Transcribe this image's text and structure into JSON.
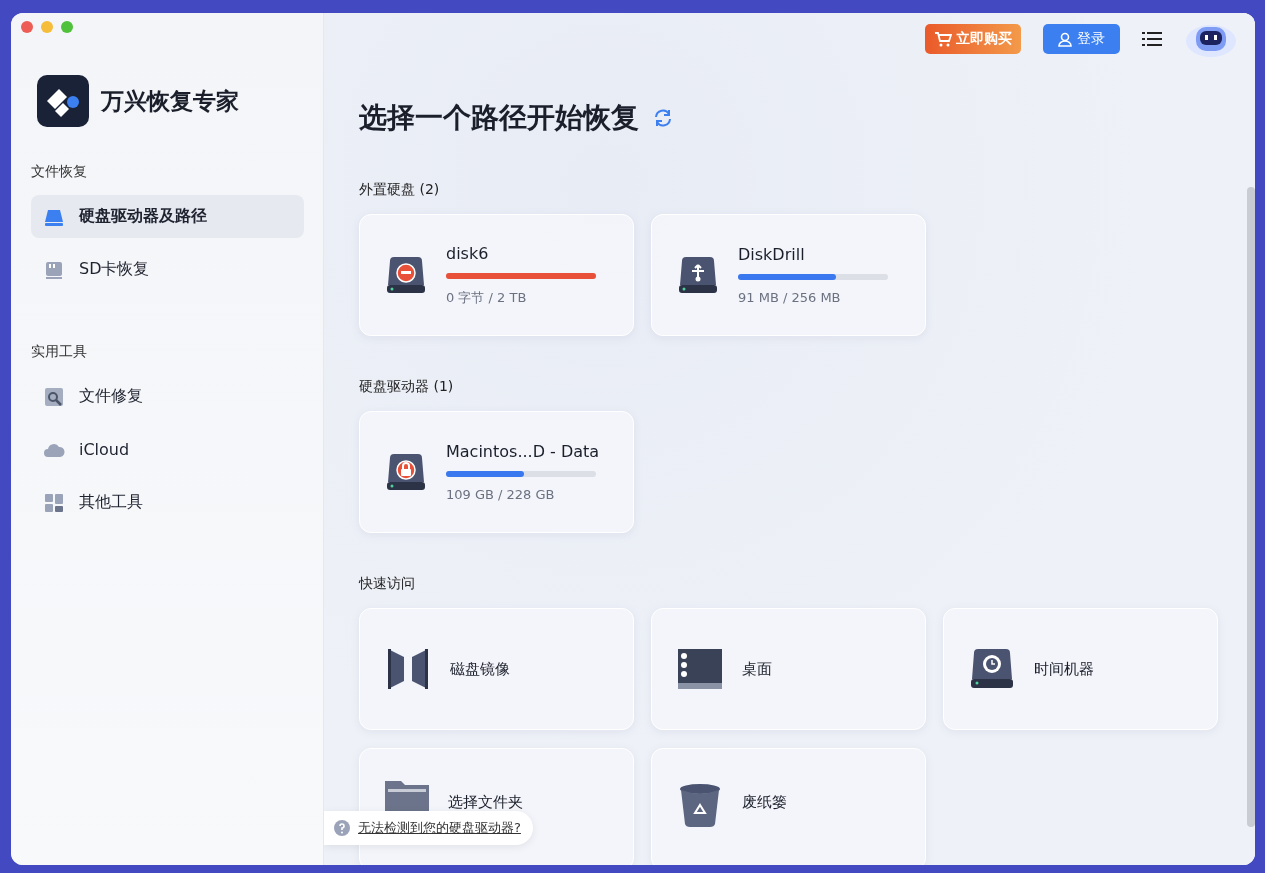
{
  "topbar": {
    "buy_button": "立即购买",
    "login_button": "登录"
  },
  "sidebar": {
    "app_name": "万兴恢复专家",
    "sections": [
      {
        "title": "文件恢复",
        "items": [
          {
            "label": "硬盘驱动器及路径",
            "kind": "drive",
            "selected": true
          },
          {
            "label": "SD卡恢复",
            "kind": "sd",
            "selected": false
          }
        ]
      },
      {
        "title": "实用工具",
        "items": [
          {
            "label": "文件修复",
            "kind": "repair",
            "selected": false
          },
          {
            "label": "iCloud",
            "kind": "cloud",
            "selected": false
          },
          {
            "label": "其他工具",
            "kind": "tools",
            "selected": false
          }
        ]
      }
    ]
  },
  "main": {
    "title": "选择一个路径开始恢复",
    "groups": [
      {
        "title": "外置硬盘 (2)",
        "items": [
          {
            "name": "disk6",
            "kind": "minus",
            "level": 1,
            "color": "#e8503a",
            "usage": "0 字节 / 2 TB"
          },
          {
            "name": "DiskDrill",
            "kind": "usb",
            "level": 0.65,
            "color": "#3a78f0",
            "usage": "91 MB / 256 MB"
          }
        ]
      },
      {
        "title": "硬盘驱动器 (1)",
        "items": [
          {
            "name": "Macintos...D - Data",
            "kind": "lock",
            "level": 0.52,
            "color": "#3a78f0",
            "usage": "109 GB / 228 GB"
          }
        ]
      }
    ],
    "quick_access": {
      "title": "快速访问",
      "items": [
        {
          "label": "磁盘镜像",
          "kind": "image"
        },
        {
          "label": "桌面",
          "kind": "desktop"
        },
        {
          "label": "时间机器",
          "kind": "timemachine"
        },
        {
          "label": "选择文件夹",
          "kind": "folder"
        },
        {
          "label": "废纸篓",
          "kind": "trash"
        }
      ]
    },
    "help_link": "无法检测到您的硬盘驱动器?"
  }
}
